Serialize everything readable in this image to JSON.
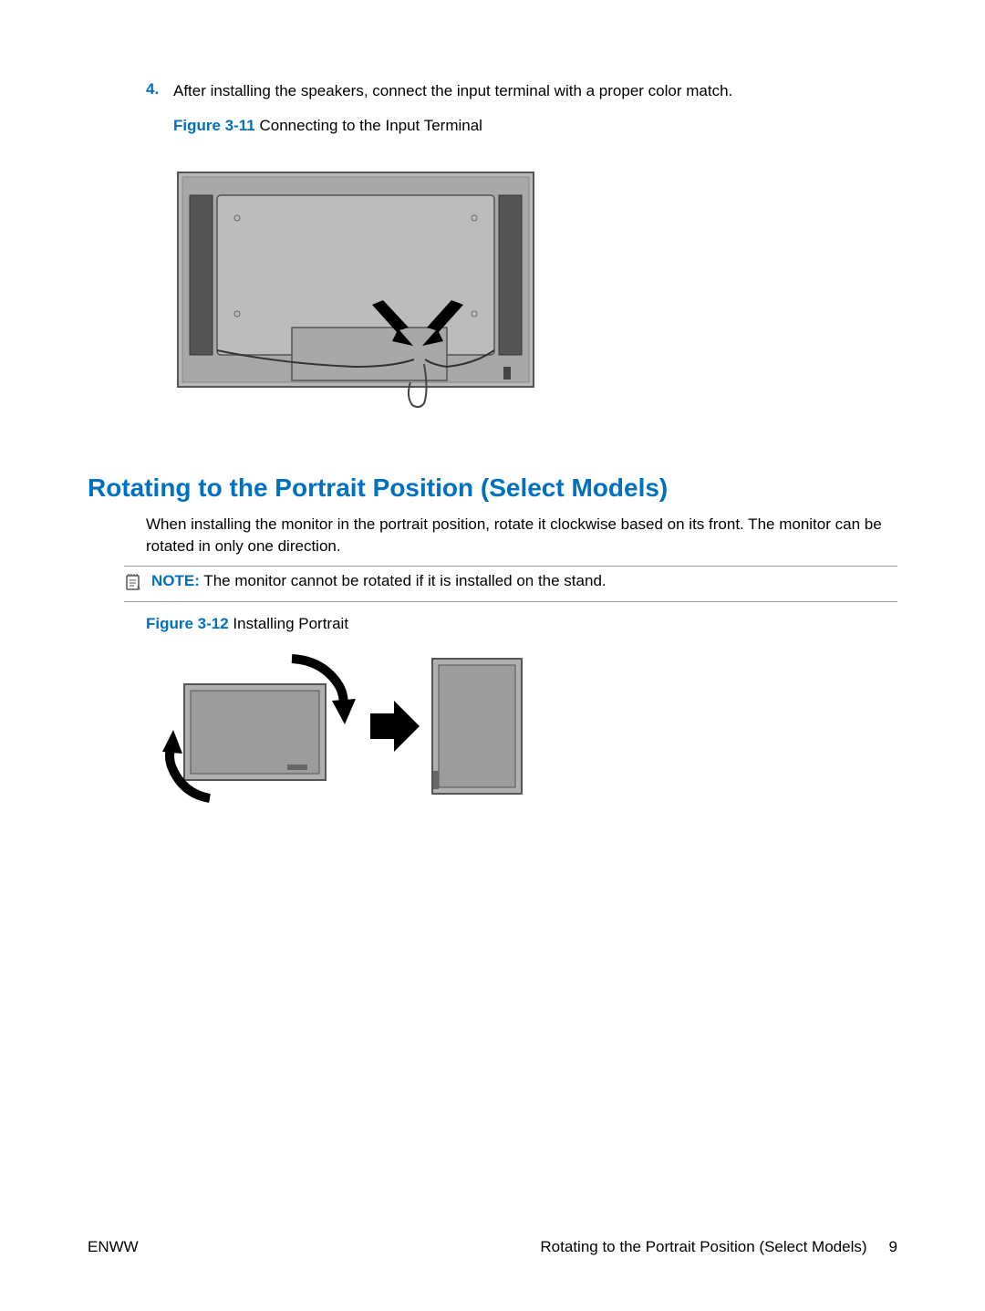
{
  "step": {
    "number": "4.",
    "text": "After installing the speakers, connect the input terminal with a proper color match."
  },
  "figure1": {
    "label": "Figure 3-11",
    "title": "  Connecting to the Input Terminal"
  },
  "heading": "Rotating to the Portrait Position (Select Models)",
  "bodyText": "When installing the monitor in the portrait position, rotate it clockwise based on its front. The monitor can be rotated in only one direction.",
  "note": {
    "label": "NOTE:",
    "text": "   The monitor cannot be rotated if it is installed on the stand."
  },
  "figure2": {
    "label": "Figure 3-12",
    "title": "  Installing Portrait"
  },
  "footer": {
    "left": "ENWW",
    "rightText": "Rotating to the Portrait Position (Select Models)",
    "pageNumber": "9"
  }
}
